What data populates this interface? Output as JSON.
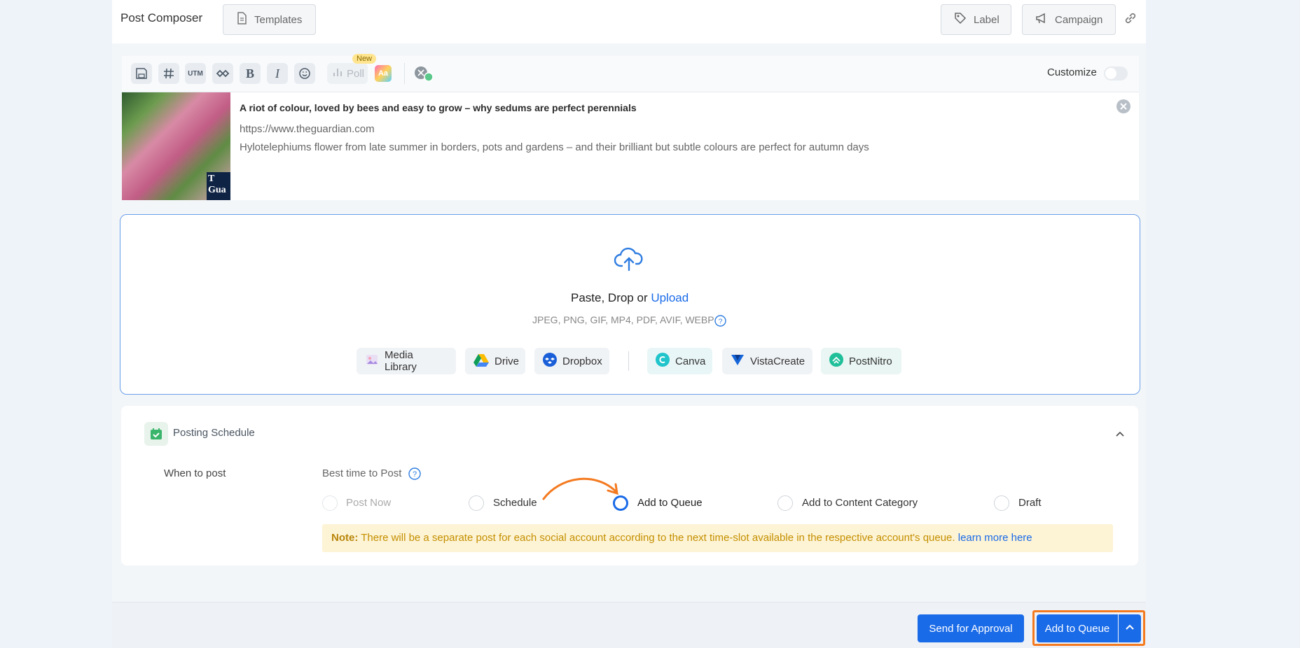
{
  "header": {
    "title": "Post Composer",
    "templates_label": "Templates",
    "label_label": "Label",
    "campaign_label": "Campaign"
  },
  "toolbar": {
    "utm_label": "UTM",
    "bold_label": "B",
    "italic_label": "I",
    "poll_label": "Poll",
    "new_badge": "New",
    "aa_label": "Aa",
    "customize_label": "Customize"
  },
  "link_preview": {
    "title": "A riot of colour, loved by bees and easy to grow – why sedums are perfect perennials",
    "url": "https://www.theguardian.com",
    "description": "Hylotelephiums flower from late summer in borders, pots and gardens – and their brilliant but subtle colours are perfect for autumn days",
    "logo_text": "T\nGua"
  },
  "dropzone": {
    "prompt": "Paste, Drop or ",
    "upload_link": "Upload",
    "formats": "JPEG, PNG, GIF, MP4, PDF, AVIF, WEBP",
    "sources": [
      "Media Library",
      "Drive",
      "Dropbox",
      "Canva",
      "VistaCreate",
      "PostNitro"
    ]
  },
  "schedule": {
    "section_title": "Posting Schedule",
    "when_label": "When to post",
    "best_time_label": "Best time to Post",
    "options": [
      "Post Now",
      "Schedule",
      "Add to Queue",
      "Add to Content Category",
      "Draft"
    ],
    "selected": "Add to Queue",
    "note_prefix": "Note:",
    "note_text": " There will be a separate post for each social account according to the next time-slot available in the respective account's queue. ",
    "note_link": "learn more here"
  },
  "footer": {
    "approval_label": "Send for Approval",
    "queue_label": "Add to Queue"
  },
  "colors": {
    "accent": "#1a6be8",
    "highlight": "#f47a20",
    "note_bg": "#fdf3d5"
  }
}
